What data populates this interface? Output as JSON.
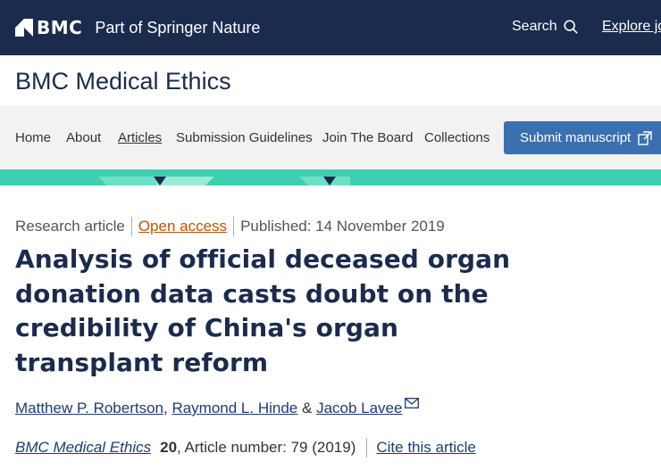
{
  "header": {
    "brand": "BMC",
    "tagline": "Part of Springer Nature",
    "search_label": "Search",
    "explore_label": "Explore jo"
  },
  "journal": {
    "title": "BMC Medical Ethics"
  },
  "nav": {
    "items": [
      {
        "label": "Home"
      },
      {
        "label": "About"
      },
      {
        "label": "Articles"
      },
      {
        "label": "Submission Guidelines"
      },
      {
        "label": "Join The Board"
      },
      {
        "label": "Collections"
      }
    ],
    "active": "Articles",
    "submit_label": "Submit manuscript"
  },
  "article": {
    "type": "Research article",
    "access": "Open access",
    "published": "Published: 14 November 2019",
    "title": "Analysis of official deceased organ donation data casts doubt on the credibility of China's organ transplant reform",
    "authors": [
      {
        "name": "Matthew P. Robertson"
      },
      {
        "name": "Raymond L. Hinde"
      },
      {
        "name": "Jacob Lavee"
      }
    ],
    "author_sep_1": ", ",
    "author_sep_2": " & ",
    "citation": {
      "journal": "BMC Medical Ethics",
      "volume": "20",
      "article_number": ", Article number: 79 (2019)",
      "cite_label": "Cite this article"
    }
  },
  "colors": {
    "header_bg": "#1a2b4d",
    "accent_teal": "#3ecfb0",
    "submit_bg": "#3a6fb0",
    "open_access": "#c65301"
  }
}
